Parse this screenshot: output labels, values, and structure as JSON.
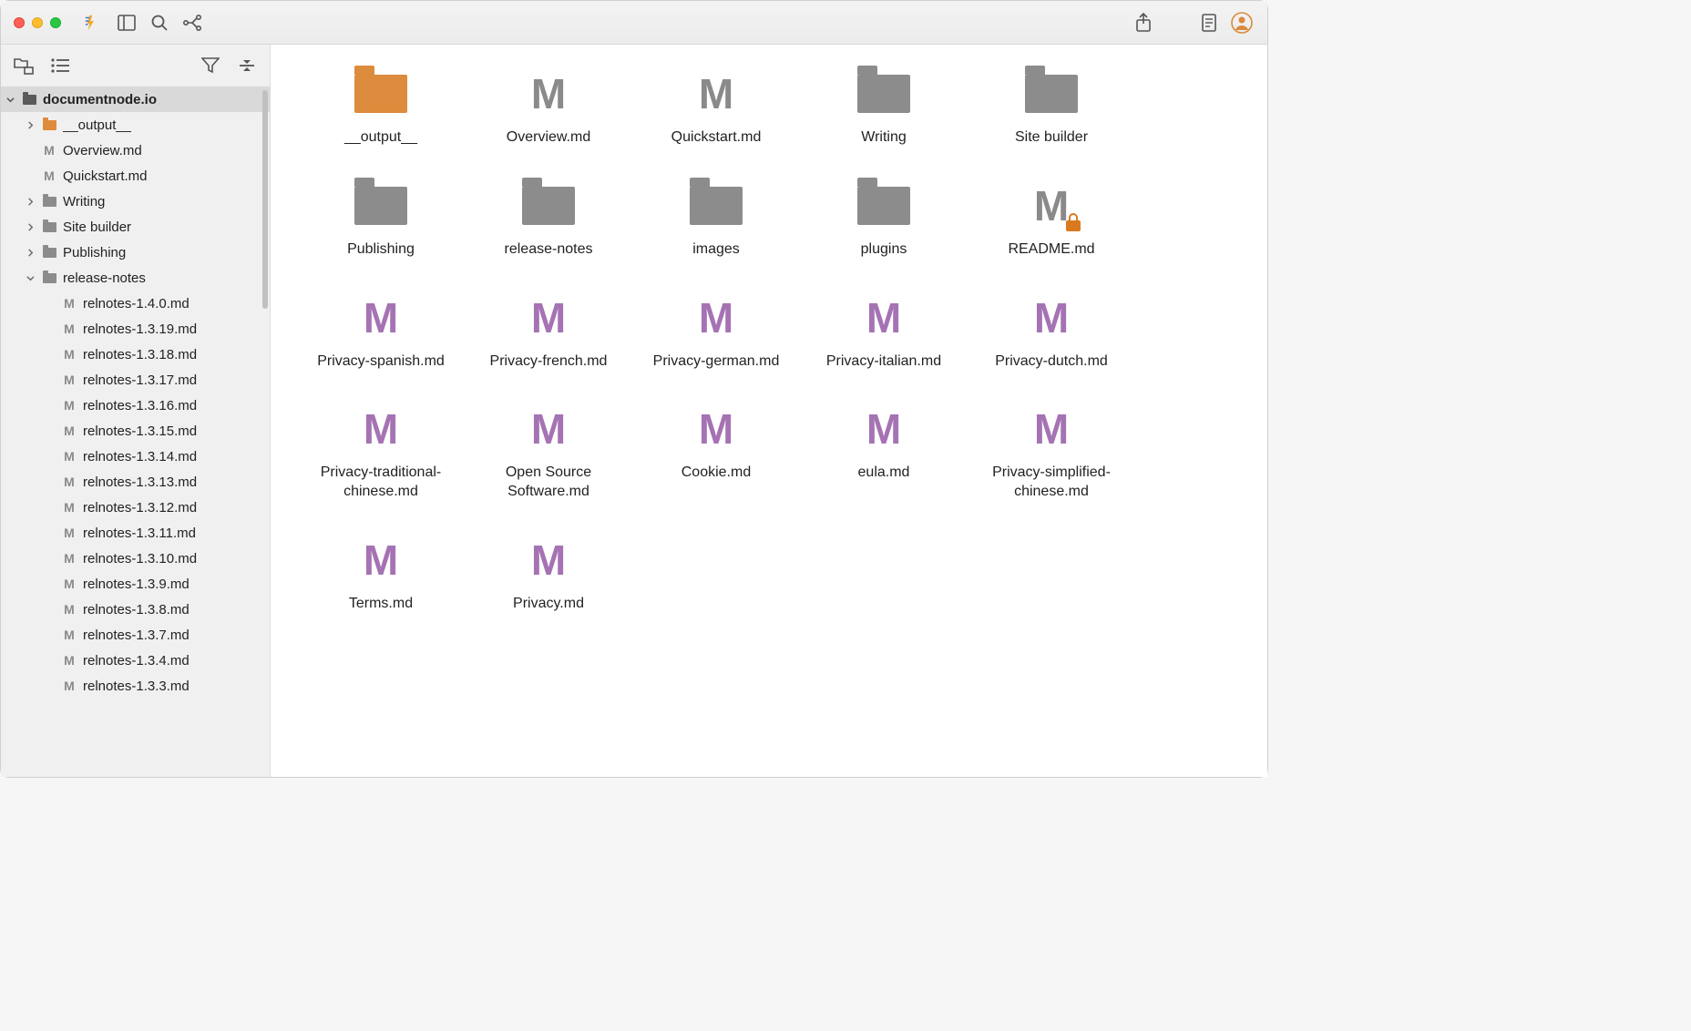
{
  "sidebar": {
    "root": "documentnode.io",
    "tree": [
      {
        "type": "folder",
        "label": "__output__",
        "indent": 1,
        "toggle": "closed",
        "color": "orange"
      },
      {
        "type": "file",
        "label": "Overview.md",
        "indent": 1,
        "icon": "m"
      },
      {
        "type": "file",
        "label": "Quickstart.md",
        "indent": 1,
        "icon": "m"
      },
      {
        "type": "folder",
        "label": "Writing",
        "indent": 1,
        "toggle": "closed"
      },
      {
        "type": "folder",
        "label": "Site builder",
        "indent": 1,
        "toggle": "closed"
      },
      {
        "type": "folder",
        "label": "Publishing",
        "indent": 1,
        "toggle": "closed"
      },
      {
        "type": "folder",
        "label": "release-notes",
        "indent": 1,
        "toggle": "open"
      },
      {
        "type": "file",
        "label": "relnotes-1.4.0.md",
        "indent": 2,
        "icon": "m"
      },
      {
        "type": "file",
        "label": "relnotes-1.3.19.md",
        "indent": 2,
        "icon": "m"
      },
      {
        "type": "file",
        "label": "relnotes-1.3.18.md",
        "indent": 2,
        "icon": "m"
      },
      {
        "type": "file",
        "label": "relnotes-1.3.17.md",
        "indent": 2,
        "icon": "m"
      },
      {
        "type": "file",
        "label": "relnotes-1.3.16.md",
        "indent": 2,
        "icon": "m"
      },
      {
        "type": "file",
        "label": "relnotes-1.3.15.md",
        "indent": 2,
        "icon": "m"
      },
      {
        "type": "file",
        "label": "relnotes-1.3.14.md",
        "indent": 2,
        "icon": "m"
      },
      {
        "type": "file",
        "label": "relnotes-1.3.13.md",
        "indent": 2,
        "icon": "m"
      },
      {
        "type": "file",
        "label": "relnotes-1.3.12.md",
        "indent": 2,
        "icon": "m"
      },
      {
        "type": "file",
        "label": "relnotes-1.3.11.md",
        "indent": 2,
        "icon": "m"
      },
      {
        "type": "file",
        "label": "relnotes-1.3.10.md",
        "indent": 2,
        "icon": "m"
      },
      {
        "type": "file",
        "label": "relnotes-1.3.9.md",
        "indent": 2,
        "icon": "m"
      },
      {
        "type": "file",
        "label": "relnotes-1.3.8.md",
        "indent": 2,
        "icon": "m"
      },
      {
        "type": "file",
        "label": "relnotes-1.3.7.md",
        "indent": 2,
        "icon": "m"
      },
      {
        "type": "file",
        "label": "relnotes-1.3.4.md",
        "indent": 2,
        "icon": "m"
      },
      {
        "type": "file",
        "label": "relnotes-1.3.3.md",
        "indent": 2,
        "icon": "m"
      }
    ]
  },
  "grid": [
    {
      "label": "__output__",
      "type": "folder",
      "color": "orange"
    },
    {
      "label": "Overview.md",
      "type": "m",
      "color": "gray"
    },
    {
      "label": "Quickstart.md",
      "type": "m",
      "color": "gray"
    },
    {
      "label": "Writing",
      "type": "folder"
    },
    {
      "label": "Site builder",
      "type": "folder"
    },
    {
      "label": "Publishing",
      "type": "folder"
    },
    {
      "label": "release-notes",
      "type": "folder"
    },
    {
      "label": "images",
      "type": "folder"
    },
    {
      "label": "plugins",
      "type": "folder"
    },
    {
      "label": "README.md",
      "type": "m",
      "color": "gray",
      "locked": true
    },
    {
      "label": "Privacy-spanish.md",
      "type": "m",
      "color": "purple"
    },
    {
      "label": "Privacy-french.md",
      "type": "m",
      "color": "purple"
    },
    {
      "label": "Privacy-german.md",
      "type": "m",
      "color": "purple"
    },
    {
      "label": "Privacy-italian.md",
      "type": "m",
      "color": "purple"
    },
    {
      "label": "Privacy-dutch.md",
      "type": "m",
      "color": "purple"
    },
    {
      "label": "Privacy-traditional-chinese.md",
      "type": "m",
      "color": "purple"
    },
    {
      "label": "Open Source Software.md",
      "type": "m",
      "color": "purple"
    },
    {
      "label": "Cookie.md",
      "type": "m",
      "color": "purple"
    },
    {
      "label": "eula.md",
      "type": "m",
      "color": "purple"
    },
    {
      "label": "Privacy-simplified-chinese.md",
      "type": "m",
      "color": "purple"
    },
    {
      "label": "Terms.md",
      "type": "m",
      "color": "purple"
    },
    {
      "label": "Privacy.md",
      "type": "m",
      "color": "purple"
    }
  ]
}
